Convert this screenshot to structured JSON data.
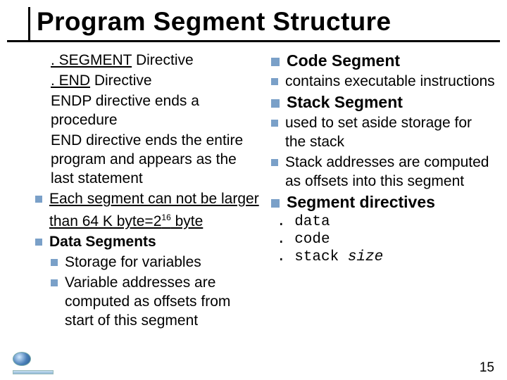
{
  "title": "Program Segment Structure",
  "left": {
    "l1a": ". SEGMENT",
    "l1b": " Directive",
    "l2a": ". END",
    "l2b": " Directive",
    "l3": "ENDP directive ends a procedure",
    "l4": "END directive ends the entire program and appears as the last statement",
    "l5a": "Each segment can not be larger than 64 K byte=2",
    "l5sup": "16",
    "l5b": " byte",
    "l6": "Data Segments",
    "l7": "Storage for variables",
    "l8": "Variable addresses are computed as offsets from start of this segment"
  },
  "right": {
    "r1": "Code Segment",
    "r2": "contains executable instructions",
    "r3": "Stack Segment",
    "r4": "used to set aside storage for the stack",
    "r5": "Stack addresses are computed as offsets into this segment",
    "r6": "Segment directives",
    "m1": ". data",
    "m2": ". code",
    "m3a": ". stack ",
    "m3b": "size"
  },
  "page": "15"
}
